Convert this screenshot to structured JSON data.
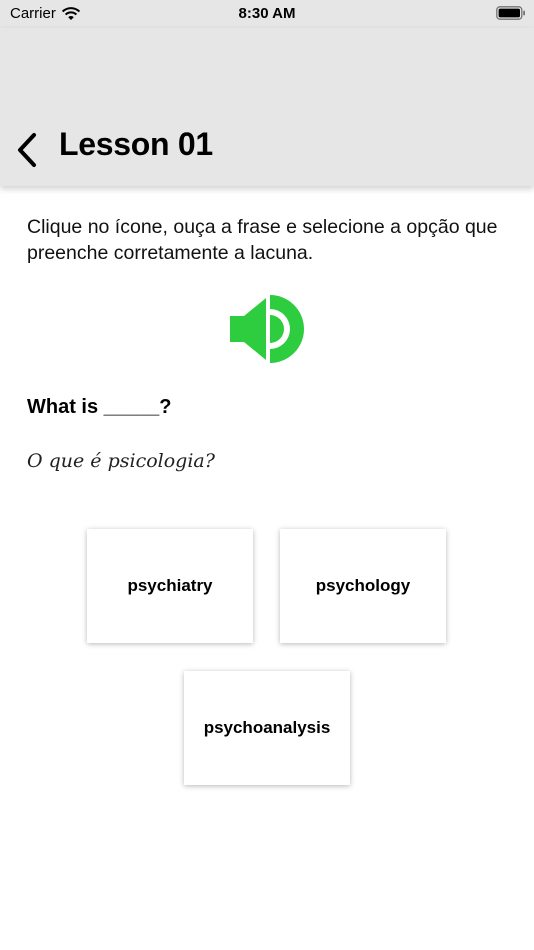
{
  "status_bar": {
    "carrier": "Carrier",
    "time": "8:30 AM"
  },
  "nav": {
    "title": "Lesson 01"
  },
  "lesson": {
    "instruction": "Clique no ícone, ouça a frase e selecione a opção que preenche corretamente a lacuna.",
    "question": "What is _____?",
    "translation": "O que é psicologia?"
  },
  "options": [
    {
      "label": "psychiatry"
    },
    {
      "label": "psychology"
    },
    {
      "label": "psychoanalysis"
    }
  ],
  "icons": {
    "back": "chevron-left-icon",
    "speaker": "speaker-icon",
    "wifi": "wifi-icon",
    "battery": "battery-icon"
  },
  "colors": {
    "accent": "#2ecc3f",
    "bar_background": "#e6e6e6"
  }
}
